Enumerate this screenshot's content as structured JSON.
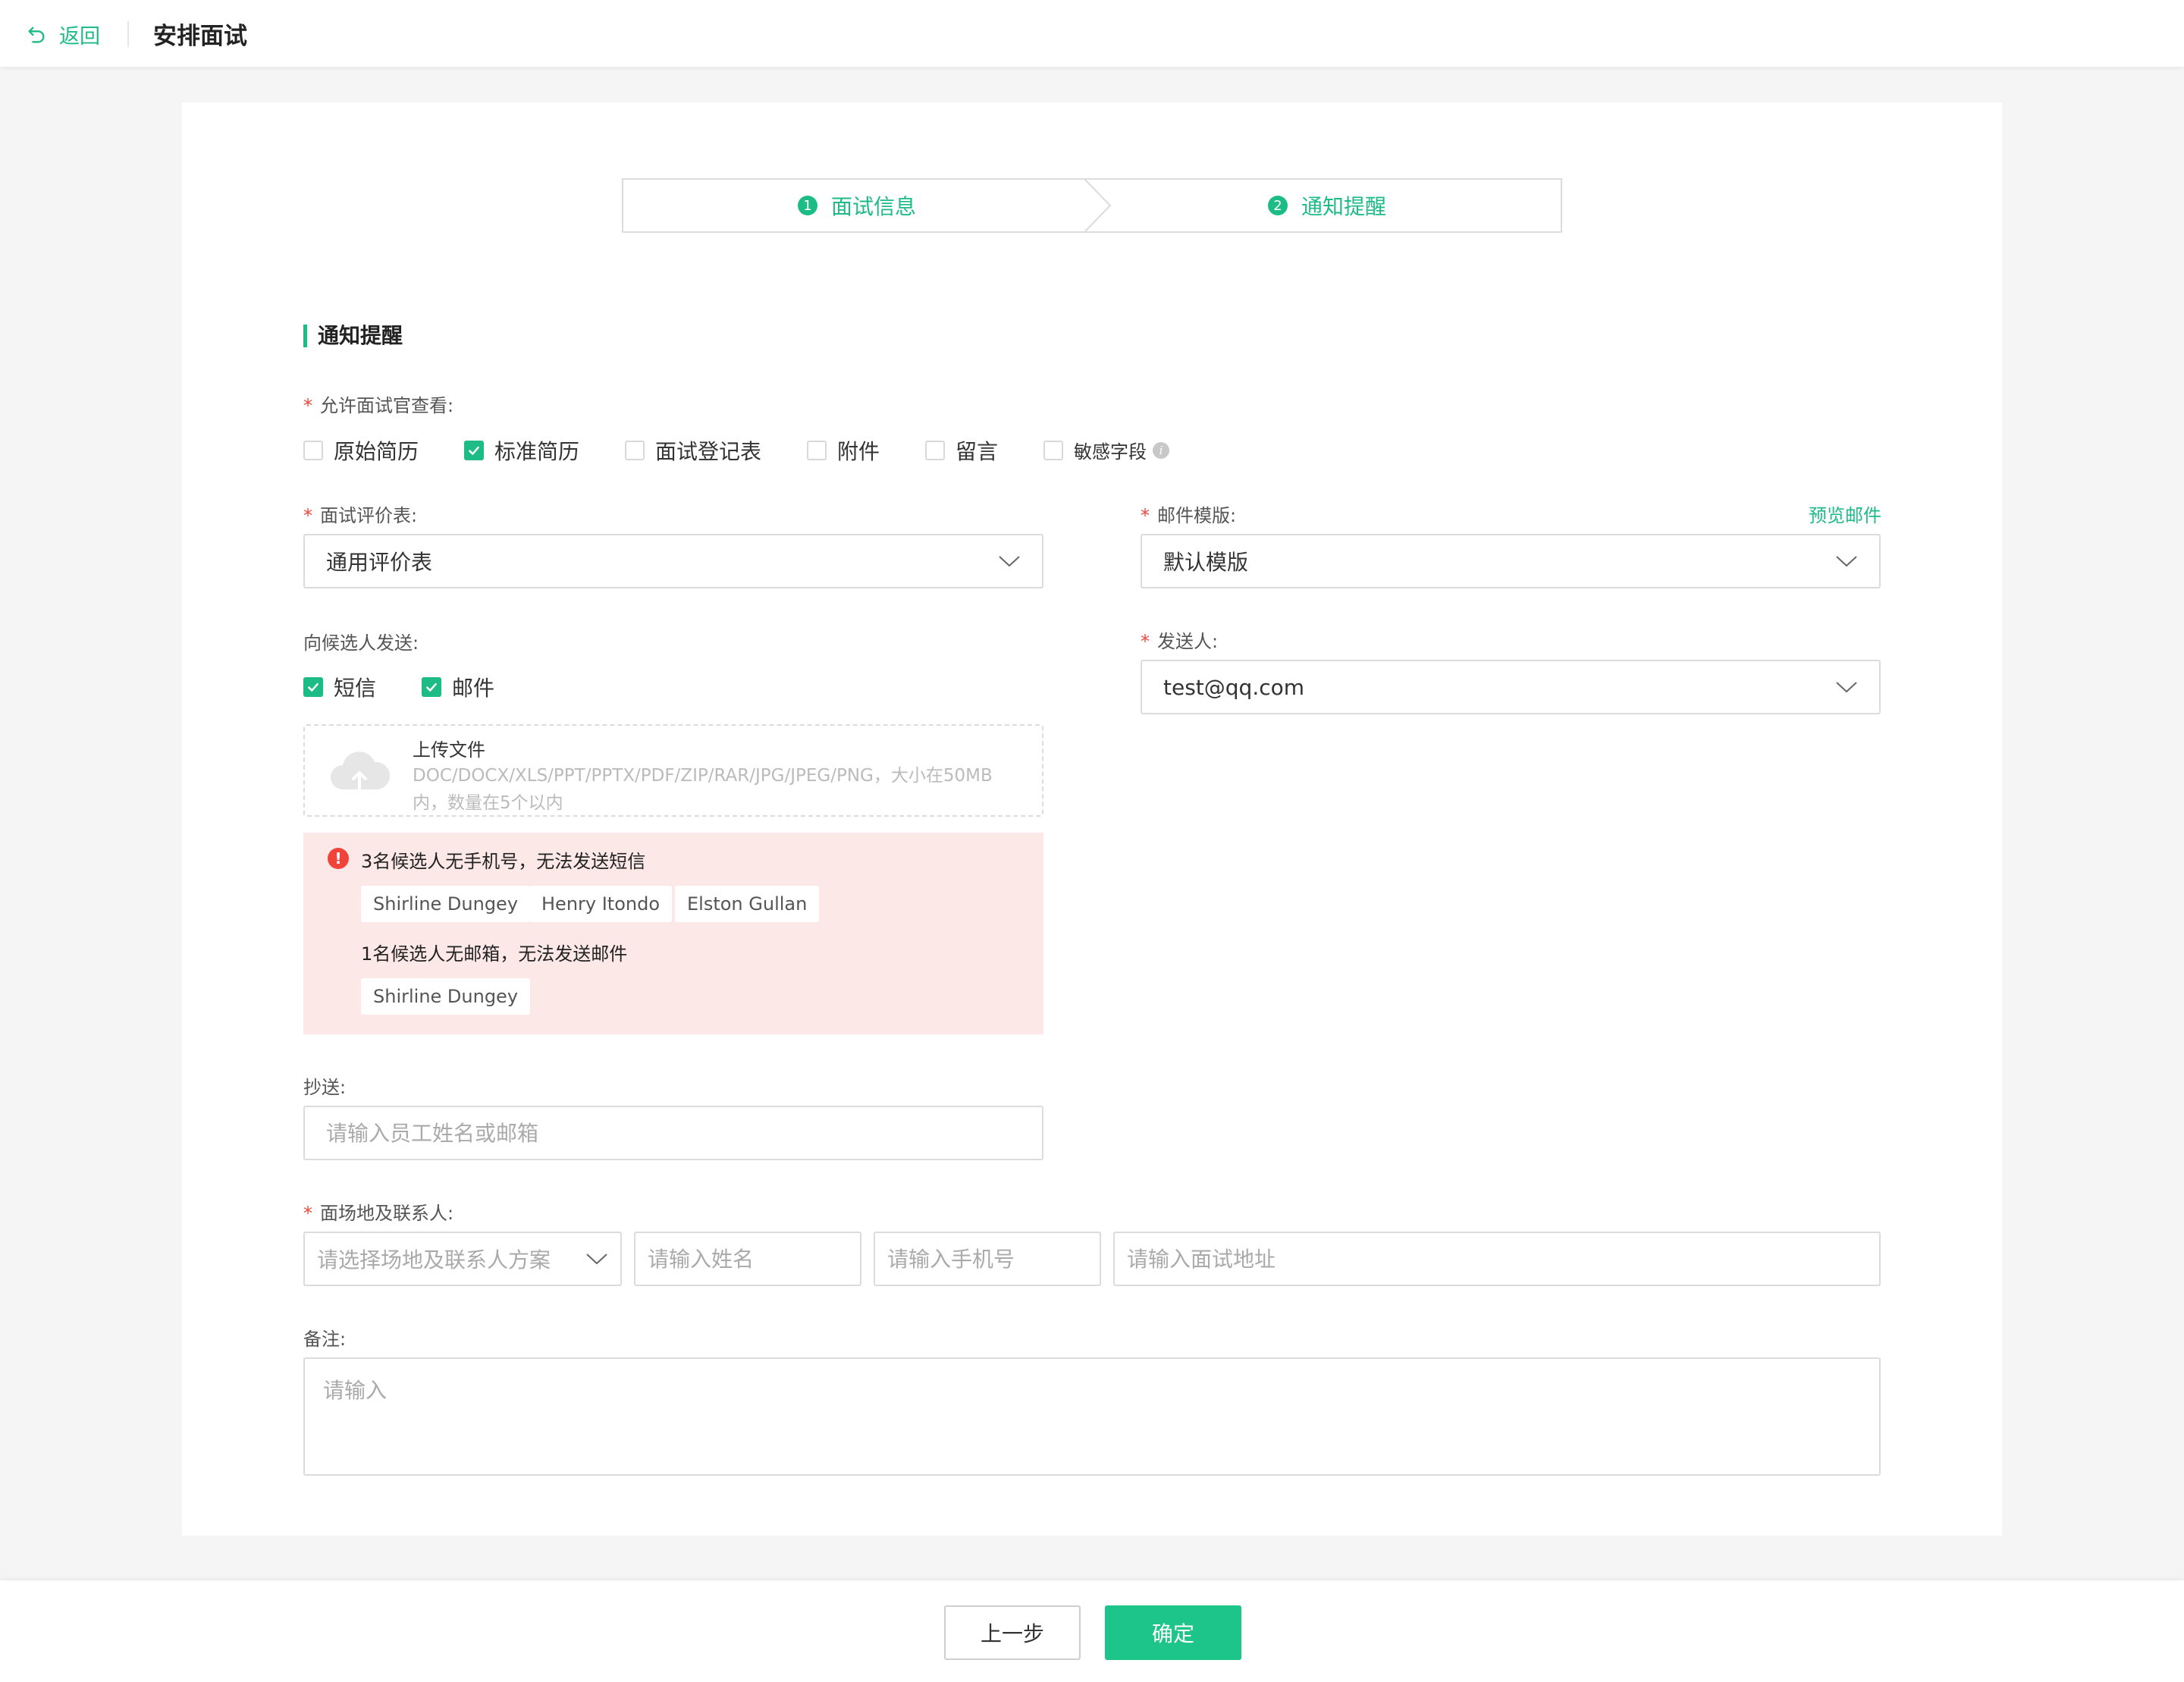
{
  "header": {
    "back_label": "返回",
    "title": "安排面试"
  },
  "steps": [
    {
      "num": "1",
      "label": "面试信息"
    },
    {
      "num": "2",
      "label": "通知提醒"
    }
  ],
  "section_title": "通知提醒",
  "allow_view": {
    "label": "允许面试官查看:",
    "options": [
      {
        "label": "原始简历",
        "checked": false
      },
      {
        "label": "标准简历",
        "checked": true
      },
      {
        "label": "面试登记表",
        "checked": false
      },
      {
        "label": "附件",
        "checked": false
      },
      {
        "label": "留言",
        "checked": false
      },
      {
        "label": "敏感字段",
        "checked": false
      }
    ]
  },
  "eval_form": {
    "label": "面试评价表:",
    "value": "通用评价表"
  },
  "mail_template": {
    "label": "邮件模版:",
    "value": "默认模版",
    "preview_label": "预览邮件"
  },
  "send_to_candidate": {
    "label": "向候选人发送:",
    "options": [
      {
        "label": "短信",
        "checked": true
      },
      {
        "label": "邮件",
        "checked": true
      }
    ]
  },
  "sender": {
    "label": "发送人:",
    "value": "test@qq.com"
  },
  "upload": {
    "title": "上传文件",
    "hint": "DOC/DOCX/XLS/PPT/PPTX/PDF/ZIP/RAR/JPG/JPEG/PNG，大小在50MB内，数量在5个以内"
  },
  "warning": {
    "icon": "!",
    "sms_message": "3名候选人无手机号，无法发送短信",
    "sms_candidates": [
      "Shirline Dungey",
      "Henry Itondo",
      "Elston Gullan"
    ],
    "mail_message": "1名候选人无邮箱，无法发送邮件",
    "mail_candidates": [
      "Shirline Dungey"
    ]
  },
  "cc": {
    "label": "抄送:",
    "placeholder": "请输入员工姓名或邮箱"
  },
  "venue": {
    "label": "面场地及联系人:",
    "scheme_placeholder": "请选择场地及联系人方案",
    "name_placeholder": "请输入姓名",
    "phone_placeholder": "请输入手机号",
    "address_placeholder": "请输入面试地址"
  },
  "remark": {
    "label": "备注:",
    "placeholder": "请输入"
  },
  "footer": {
    "prev_label": "上一步",
    "confirm_label": "确定"
  },
  "colors": {
    "accent": "#1dbb86",
    "required": "#f0443b",
    "warning_bg": "#fde8e8"
  }
}
